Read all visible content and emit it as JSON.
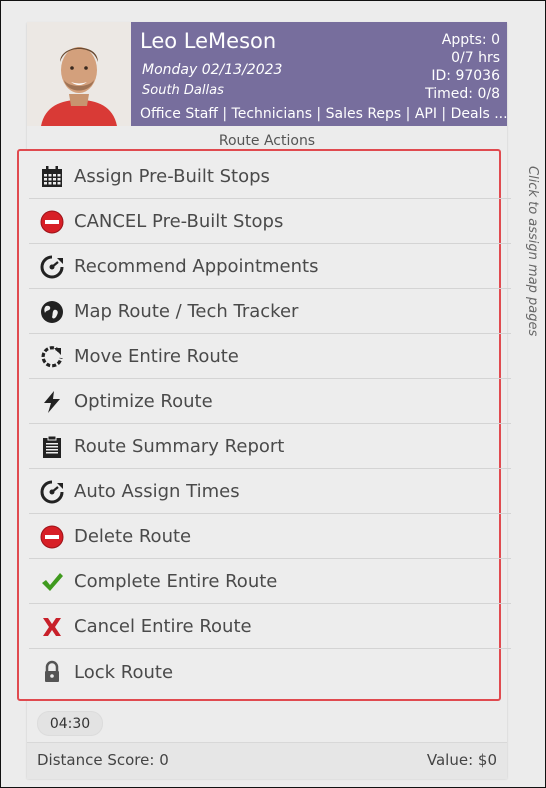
{
  "tech": {
    "name": "Leo LeMeson",
    "date": "Monday 02/13/2023",
    "branch": "South Dallas",
    "groups": "Office Staff | Technicians | Sales Reps | API | Deals ..."
  },
  "stats": {
    "appts": "Appts: 0",
    "hours": "0/7 hrs",
    "id": "ID: 97036",
    "timed": "Timed: 0/8"
  },
  "route_actions_label": "Route Actions",
  "side_label": "Click to assign map pages",
  "menu": [
    {
      "label": "Assign Pre-Built Stops",
      "icon": "calendar-icon"
    },
    {
      "label": "CANCEL Pre-Built Stops",
      "icon": "no-entry-icon"
    },
    {
      "label": "Recommend Appointments",
      "icon": "dial-arrow-icon"
    },
    {
      "label": "Map Route / Tech Tracker",
      "icon": "globe-icon"
    },
    {
      "label": "Move Entire Route",
      "icon": "rotate-icon"
    },
    {
      "label": "Optimize Route",
      "icon": "lightning-icon"
    },
    {
      "label": "Route Summary Report",
      "icon": "clipboard-icon"
    },
    {
      "label": "Auto Assign Times",
      "icon": "dial-arrow-icon"
    },
    {
      "label": "Delete Route",
      "icon": "no-entry-icon"
    },
    {
      "label": "Complete Entire Route",
      "icon": "check-icon"
    },
    {
      "label": "Cancel Entire Route",
      "icon": "x-icon"
    },
    {
      "label": "Lock Route",
      "icon": "lock-icon"
    }
  ],
  "time_chip": "04:30",
  "footer": {
    "distance": "Distance Score: 0",
    "value": "Value: $0"
  },
  "colors": {
    "header_bg": "#776e9d",
    "highlight_border": "#e04a4f",
    "danger_red": "#d71f26",
    "check_green": "#3f9a1e"
  }
}
